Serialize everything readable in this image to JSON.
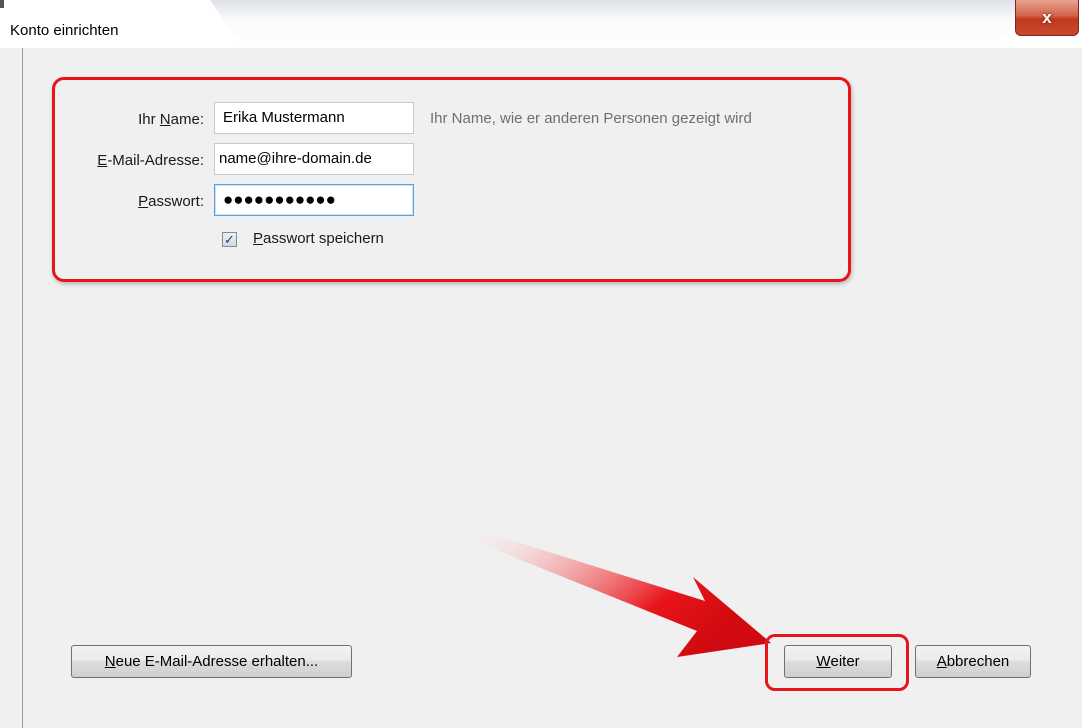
{
  "window": {
    "title": "Konto einrichten",
    "close_glyph": "x"
  },
  "form": {
    "name_label_pre": "Ihr ",
    "name_label_accel": "N",
    "name_label_post": "ame:",
    "name_value": "Erika Mustermann",
    "name_hint": "Ihr Name, wie er anderen Personen gezeigt wird",
    "email_label_accel": "E",
    "email_label_post": "-Mail-Adresse:",
    "email_value": "name@ihre-domain.de",
    "password_label_accel": "P",
    "password_label_post": "asswort:",
    "password_value": "●●●●●●●●●●●",
    "save_password_accel": "P",
    "save_password_post": "asswort speichern",
    "save_password_checked": true
  },
  "buttons": {
    "new_email_accel": "N",
    "new_email_post": "eue E-Mail-Adresse erhalten...",
    "next_accel": "W",
    "next_post": "eiter",
    "cancel_accel": "A",
    "cancel_post": "bbrechen"
  },
  "colors": {
    "highlight": "#e8141b",
    "background": "#f0f0f0",
    "hint_text": "#6f6f6f"
  },
  "icons": {
    "close": "close-icon",
    "checkbox_check": "checkmark-icon",
    "annotation_arrow": "red-arrow-icon"
  }
}
